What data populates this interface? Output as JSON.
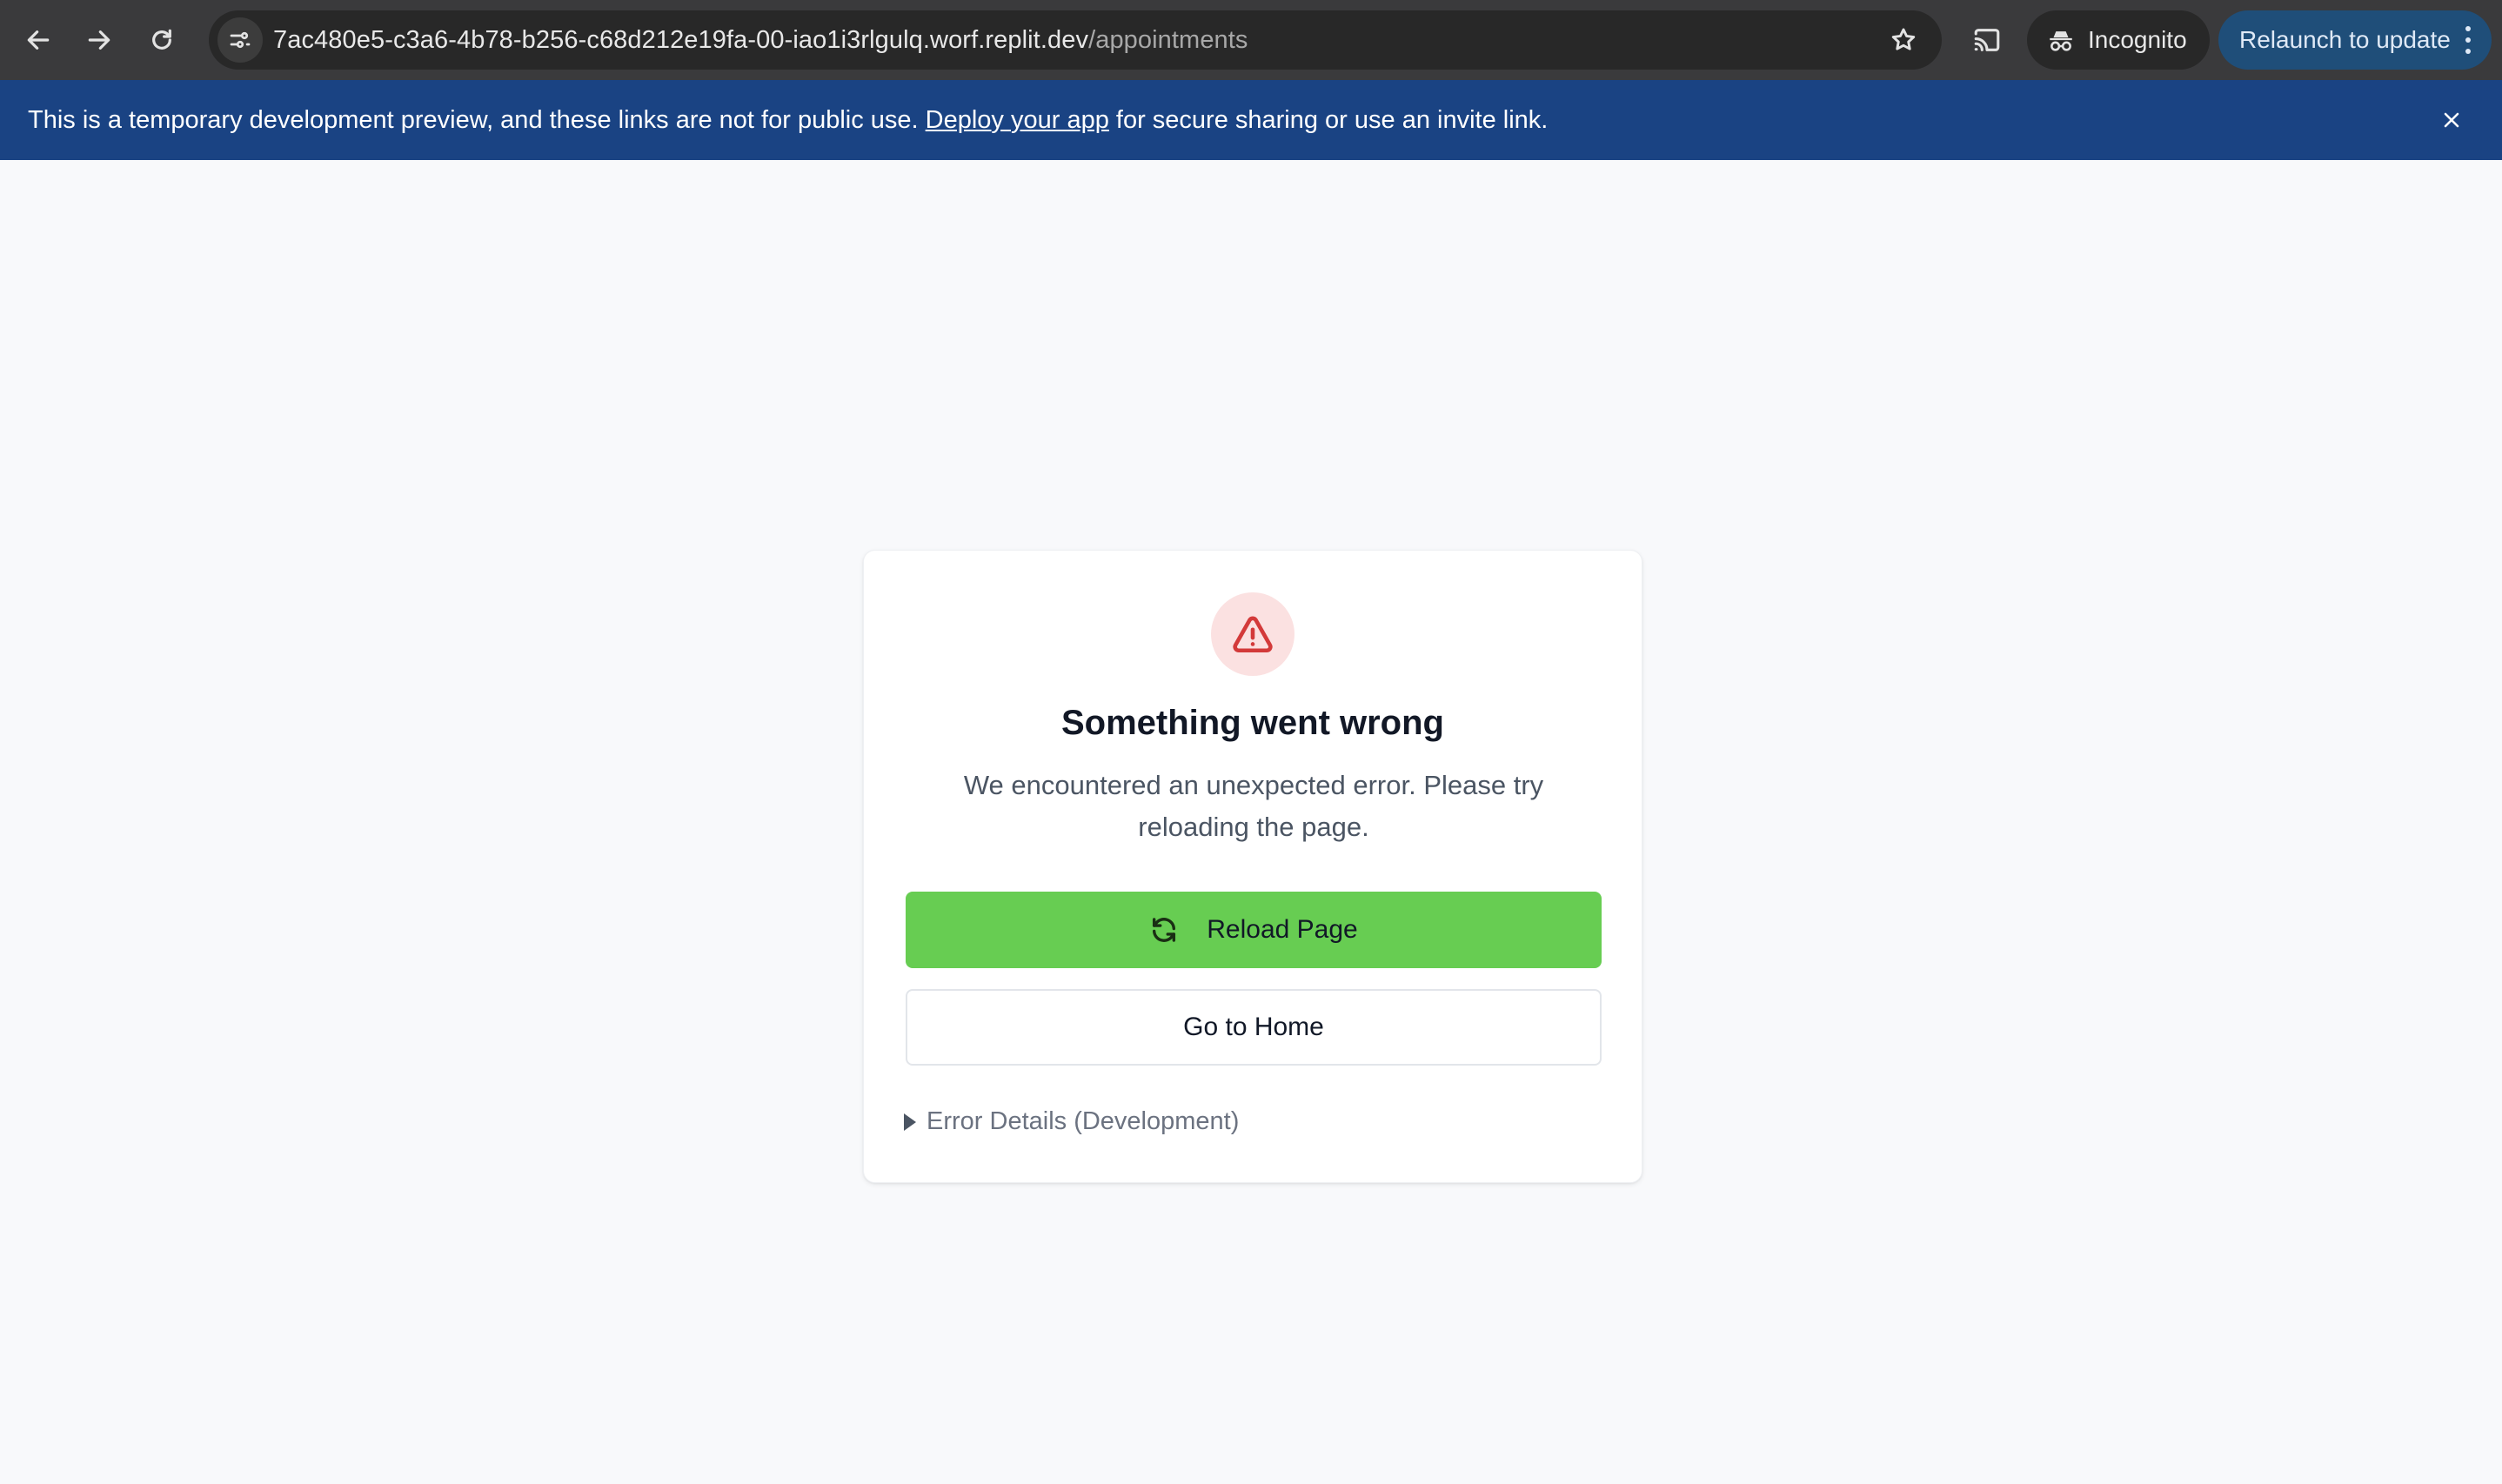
{
  "browser": {
    "url_host": "7ac480e5-c3a6-4b78-b256-c68d212e19fa-00-iao1i3rlgulq.worf.replit.dev",
    "url_path": "/appointments",
    "incognito_label": "Incognito",
    "relaunch_label": "Relaunch to update"
  },
  "banner": {
    "text_before": "This is a temporary development preview, and these links are not for public use. ",
    "link_label": "Deploy your app",
    "text_after": " for secure sharing or use an invite link."
  },
  "error_card": {
    "icon": "alert-triangle-icon",
    "title": "Something went wrong",
    "description": "We encountered an unexpected error. Please try reloading the page.",
    "reload_label": "Reload Page",
    "home_label": "Go to Home",
    "details_label": "Error Details (Development)"
  },
  "colors": {
    "chrome_bg": "#3a3a3c",
    "banner_bg": "#1a4383",
    "primary_button": "#67cd52",
    "alert_icon": "#d33a3a",
    "alert_icon_bg": "#fbe1e1"
  }
}
